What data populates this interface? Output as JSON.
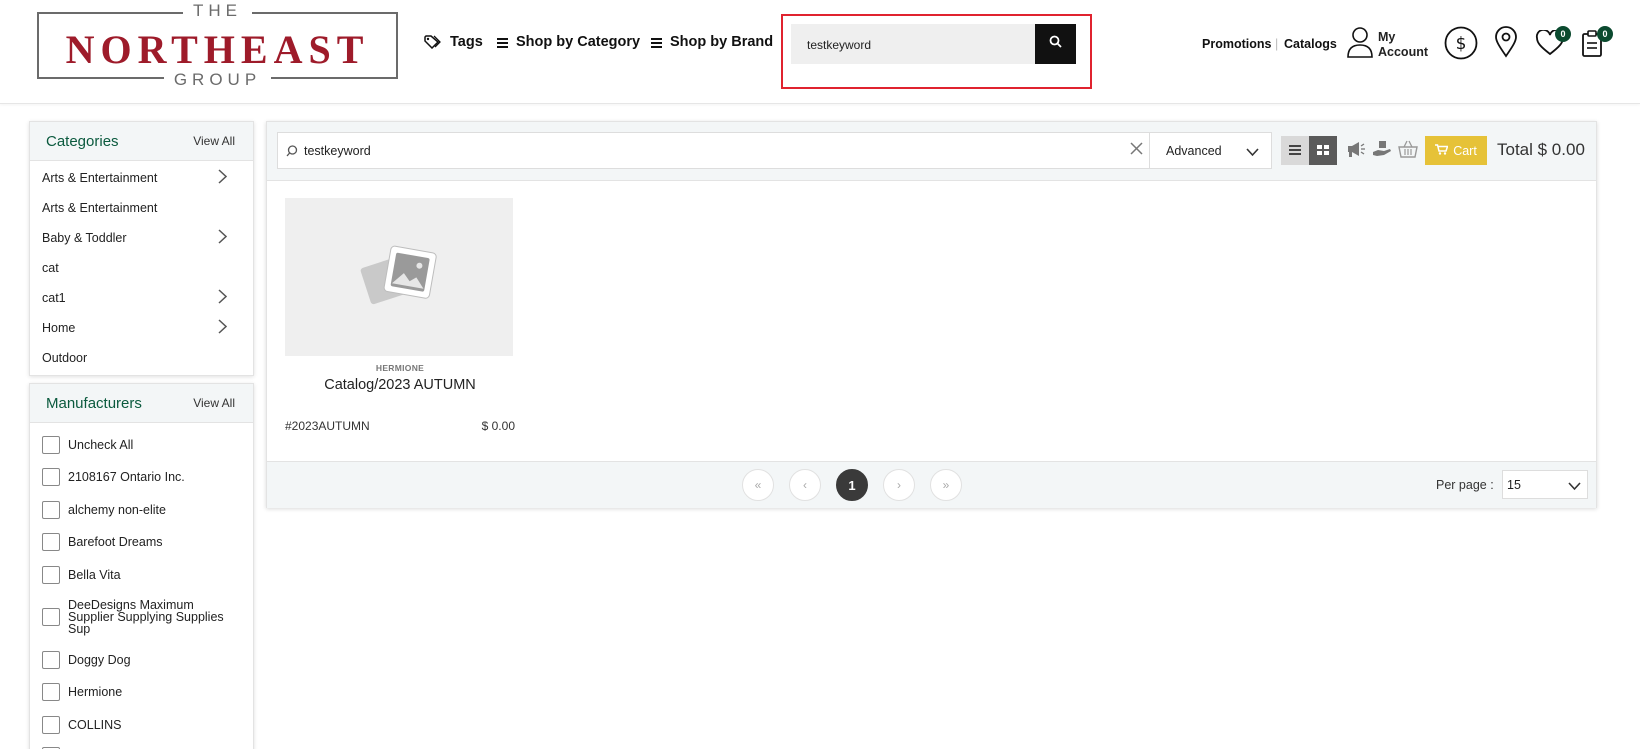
{
  "header": {
    "logo": {
      "top": "THE",
      "main": "NORTHEAST",
      "bottom": "GROUP"
    },
    "nav": {
      "tags": "Tags",
      "category": "Shop by Category",
      "brand": "Shop by Brand"
    },
    "search": {
      "value": "testkeyword"
    },
    "links": {
      "promotions": "Promotions",
      "separator": "|",
      "catalogs": "Catalogs"
    },
    "account": {
      "label_line1": "My",
      "label_line2": "Account"
    },
    "wishlist_count": "0",
    "cart_count": "0"
  },
  "sidebar": {
    "categories": {
      "title": "Categories",
      "view_all": "View All",
      "items": [
        {
          "label": "Arts & Entertainment",
          "has_children": true
        },
        {
          "label": "Arts & Entertainment",
          "has_children": false
        },
        {
          "label": "Baby & Toddler",
          "has_children": true
        },
        {
          "label": "cat",
          "has_children": false
        },
        {
          "label": "cat1",
          "has_children": true
        },
        {
          "label": "Home",
          "has_children": true
        },
        {
          "label": "Outdoor",
          "has_children": false
        }
      ]
    },
    "manufacturers": {
      "title": "Manufacturers",
      "view_all": "View All",
      "items": [
        "Uncheck All",
        "2108167 Ontario Inc.",
        "alchemy non-elite",
        "Barefoot Dreams",
        "Bella Vita",
        "DeeDesigns Maximum Supplier Supplying Supplies Sup",
        "Doggy Dog",
        "Hermione",
        "COLLINS"
      ]
    }
  },
  "main": {
    "keyword": "testkeyword",
    "advanced": "Advanced",
    "cart_label": "Cart",
    "total": "Total $ 0.00",
    "product": {
      "brand": "HERMIONE",
      "title": "Catalog/2023 AUTUMN",
      "sku": "#2023AUTUMN",
      "price": "$ 0.00"
    },
    "pager": {
      "first": "«",
      "prev": "‹",
      "current": "1",
      "next": "›",
      "last": "»",
      "per_page_label": "Per page :",
      "per_page_value": "15"
    }
  },
  "colors": {
    "brand_red": "#9e1b2a",
    "brand_green": "#0b5a3e",
    "cart_yellow": "#e6c238",
    "search_highlight": "#e0232f"
  }
}
